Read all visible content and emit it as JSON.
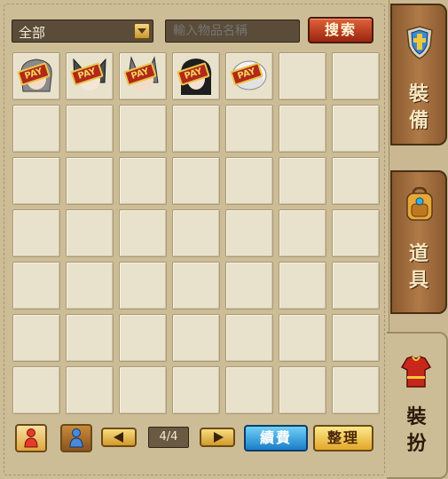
{
  "filter": {
    "selected": "全部",
    "arrow_icon": "chevron-down-icon"
  },
  "search": {
    "placeholder": "輸入物品名稱",
    "button_label": "搜索"
  },
  "inventory": {
    "columns": 7,
    "rows": 7,
    "items": [
      {
        "slot": 0,
        "icon": "gray-hair-avatar-icon",
        "badge": "PAY"
      },
      {
        "slot": 1,
        "icon": "cat-ears-avatar-icon",
        "badge": "PAY"
      },
      {
        "slot": 2,
        "icon": "bunny-ears-avatar-icon",
        "badge": "PAY"
      },
      {
        "slot": 3,
        "icon": "black-hair-avatar-icon",
        "badge": "PAY"
      },
      {
        "slot": 4,
        "icon": "white-hat-avatar-icon",
        "badge": "PAY"
      }
    ]
  },
  "bottom_bar": {
    "char_male_icon": "red-character-icon",
    "char_female_icon": "blue-character-icon",
    "page_indicator": "4/4",
    "renew_label": "續費",
    "sort_label": "整理"
  },
  "tabs": [
    {
      "label_line1": "裝",
      "label_line2": "備",
      "icon": "shield-crest-icon"
    },
    {
      "label_line1": "道",
      "label_line2": "具",
      "icon": "backpack-icon"
    },
    {
      "label_line1": "裝",
      "label_line2": "扮",
      "icon": "red-costume-icon"
    }
  ],
  "colors": {
    "panel_bg": "#cdbd97",
    "slot_bg": "#e8e1cb",
    "search_button": "#c0401f",
    "renew_button": "#1b7ec8",
    "sort_button": "#e3a72a",
    "tab_brown": "#a06a3a"
  }
}
